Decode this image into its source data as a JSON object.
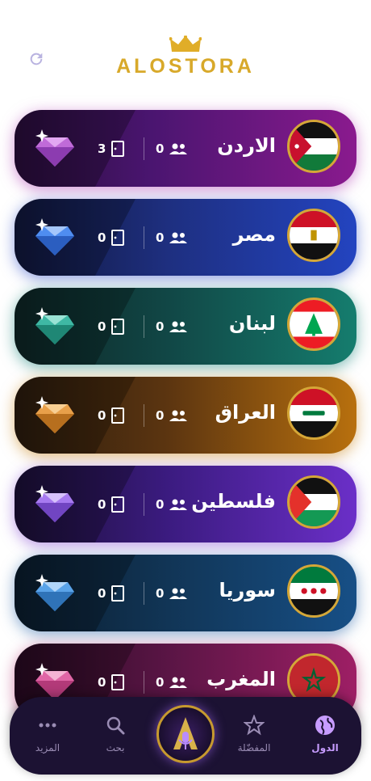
{
  "app": {
    "title": "ALOSTORA"
  },
  "header": {
    "refresh_icon": "refresh-icon",
    "logo_icon": "crown-icon"
  },
  "rooms": [
    {
      "country": "الاردن",
      "users": "0",
      "rooms": "3",
      "flag": "jordan-flag",
      "accent": "#8a1a8e",
      "gem_color": "#c06bd8"
    },
    {
      "country": "مصر",
      "users": "0",
      "rooms": "0",
      "flag": "egypt-flag",
      "accent": "#2344c0",
      "gem_color": "#4f8df0"
    },
    {
      "country": "لبنان",
      "users": "0",
      "rooms": "0",
      "flag": "lebanon-flag",
      "accent": "#157d6e",
      "gem_color": "#3fb8a4"
    },
    {
      "country": "العراق",
      "users": "0",
      "rooms": "0",
      "flag": "iraq-flag",
      "accent": "#b8700e",
      "gem_color": "#e8a04a"
    },
    {
      "country": "فلسطين",
      "users": "0",
      "rooms": "0",
      "flag": "palestine-flag",
      "accent": "#6b2fc8",
      "gem_color": "#a77af0"
    },
    {
      "country": "سوريا",
      "users": "0",
      "rooms": "0",
      "flag": "syria-flag",
      "accent": "#174f86",
      "gem_color": "#5aa3e8"
    },
    {
      "country": "المغرب",
      "users": "0",
      "rooms": "0",
      "flag": "morocco-flag",
      "accent": "#9e1f65",
      "gem_color": "#e066a6"
    }
  ],
  "nav": {
    "countries": {
      "label": "الدول",
      "icon": "globe-icon"
    },
    "favorites": {
      "label": "المفضّلة",
      "icon": "star-icon"
    },
    "center": {
      "icon": "microphone-logo-icon"
    },
    "search": {
      "label": "بحث",
      "icon": "search-icon"
    },
    "more": {
      "label": "المزيد",
      "icon": "more-dots-icon"
    }
  },
  "colors": {
    "logo_gold": "#d8a92a",
    "nav_bg": "#1c1233",
    "nav_active": "#c79cff"
  }
}
